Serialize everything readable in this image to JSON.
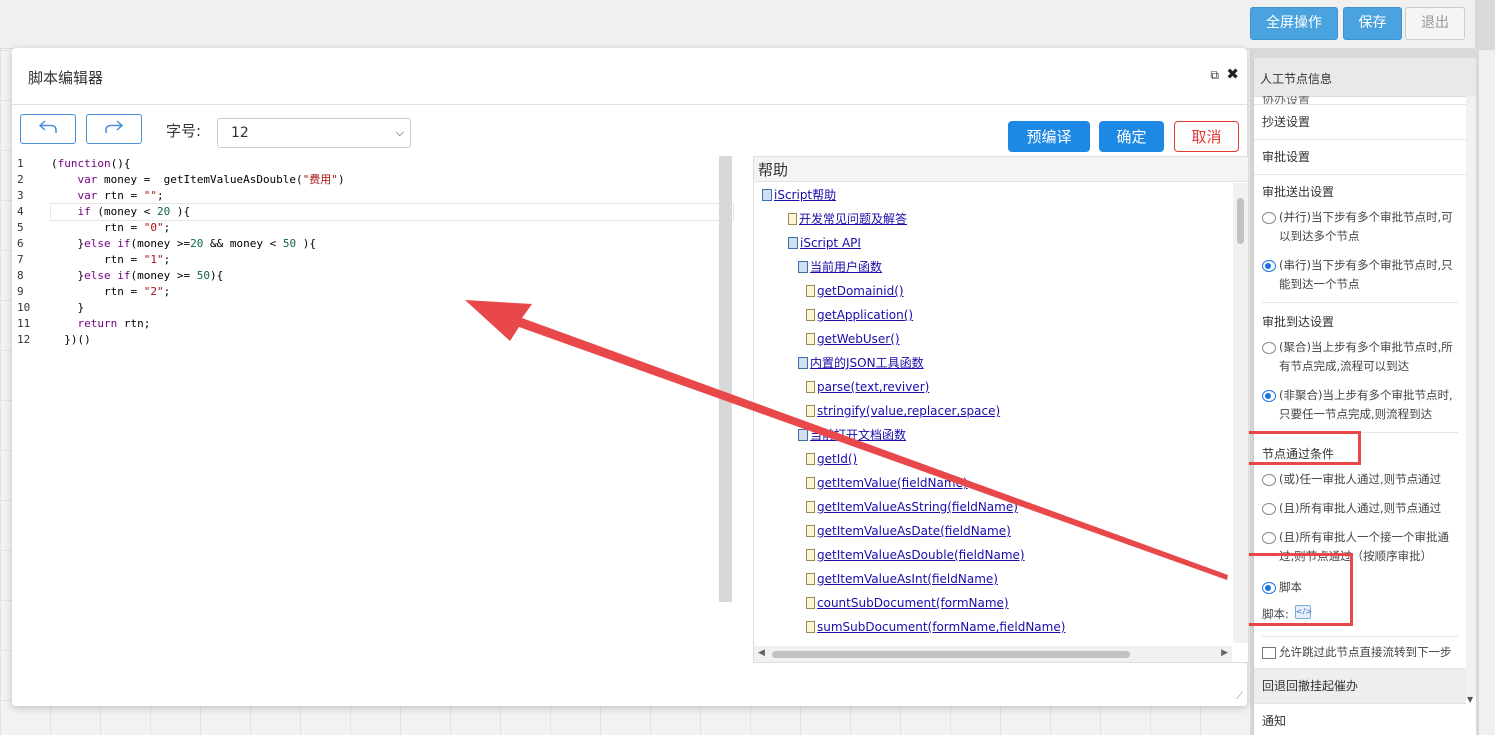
{
  "toolbar": {
    "fullscreen_label": "全屏操作",
    "save_label": "保存",
    "exit_label": "退出"
  },
  "dialog": {
    "title": "脚本编辑器",
    "undo_icon": "undo-arrow-icon",
    "redo_icon": "redo-arrow-icon",
    "font_size_label": "字号:",
    "font_size_value": "12",
    "precompile_label": "预编译",
    "confirm_label": "确定",
    "cancel_label": "取消",
    "close_glyph": "✖",
    "external_glyph": "⧉"
  },
  "editor": {
    "line_numbers": [
      "1",
      "2",
      "3",
      "4",
      "5",
      "6",
      "7",
      "8",
      "9",
      "10",
      "11",
      "12"
    ]
  },
  "help": {
    "title": "帮助",
    "items": [
      "iScript帮助",
      "开发常见问题及解答",
      "iScript API",
      "当前用户函数",
      "getDomainid()",
      "getApplication()",
      "getWebUser()",
      "内置的JSON工具函数",
      "parse(text,reviver)",
      "stringify(value,replacer,space)",
      "当前打开文档函数",
      "getId()",
      "getItemValue(fieldName)",
      "getItemValueAsString(fieldName)",
      "getItemValueAsDate(fieldName)",
      "getItemValueAsDouble(fieldName)",
      "getItemValueAsInt(fieldName)",
      "countSubDocument(formName)",
      "sumSubDocument(formName,fieldName)"
    ]
  },
  "right_panel": {
    "header": "人工节点信息",
    "sec_partial": "协办设置",
    "sec_cc": "抄送设置",
    "sec_approval": "审批设置",
    "send_title": "审批送出设置",
    "send_opt1": "(并行)当下步有多个审批节点时,可以到达多个节点",
    "send_opt2": "(串行)当下步有多个审批节点时,只能到达一个节点",
    "arrive_title": "审批到达设置",
    "arrive_opt1": "(聚合)当上步有多个审批节点时,所有节点完成,流程可以到达",
    "arrive_opt2": "(非聚合)当上步有多个审批节点时,只要任一节点完成,则流程到达",
    "pass_title": "节点通过条件",
    "pass_opt1": "(或)任一审批人通过,则节点通过",
    "pass_opt2": "(且)所有审批人通过,则节点通过",
    "pass_opt3": "(且)所有审批人一个接一个审批通过,则节点通过（按顺序审批）",
    "pass_opt4": "脚本",
    "script_label": "脚本:",
    "skip_label": "允许跳过此节点直接流转到下一步",
    "sec_rollback": "回退回撤挂起催办",
    "sec_notify": "通知"
  },
  "colors": {
    "accent_blue": "#1e88e5",
    "cancel_red": "#e53935",
    "annotation_red": "#e8484a"
  }
}
